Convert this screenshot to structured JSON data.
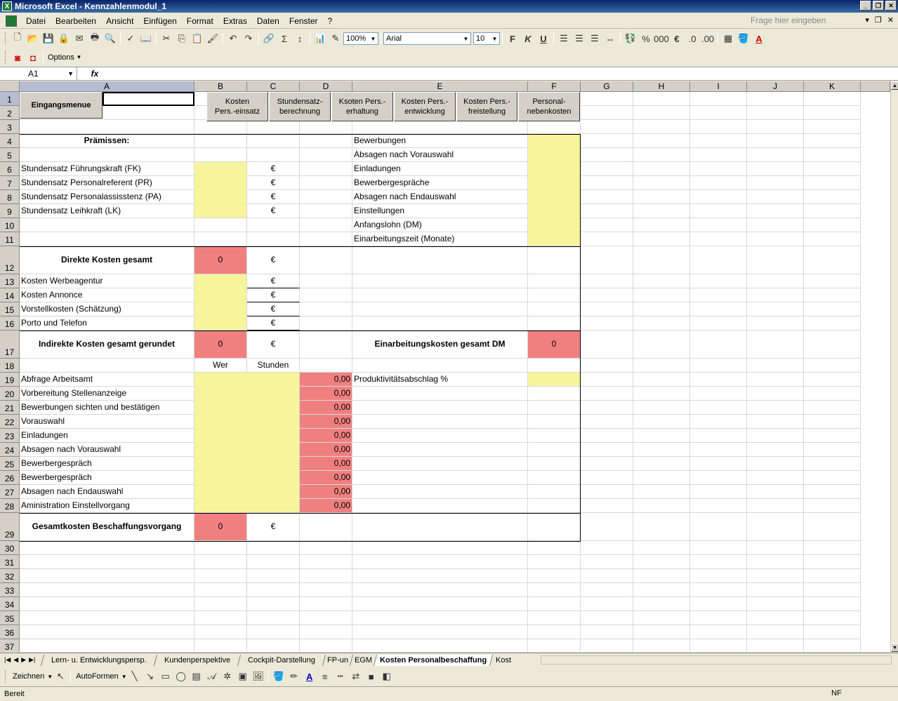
{
  "window": {
    "title": "Microsoft Excel - Kennzahlenmodul_1",
    "app_icon": "excel-icon"
  },
  "menu": [
    "Datei",
    "Bearbeiten",
    "Ansicht",
    "Einfügen",
    "Format",
    "Extras",
    "Daten",
    "Fenster",
    "?"
  ],
  "help_placeholder": "Frage hier eingeben",
  "toolbar": {
    "zoom": "100%",
    "font": "Arial",
    "size": "10",
    "bold": "F",
    "italic": "K",
    "underline": "U",
    "percent": "%",
    "thousands": "000",
    "euro": "€"
  },
  "toolbar2": {
    "options": "Options"
  },
  "namebox": "A1",
  "fx": "fx",
  "columns": [
    "A",
    "B",
    "C",
    "D",
    "E",
    "F",
    "G",
    "H",
    "I",
    "J",
    "K"
  ],
  "rows": [
    "1",
    "2",
    "3",
    "4",
    "5",
    "6",
    "7",
    "8",
    "9",
    "10",
    "11",
    "12",
    "13",
    "14",
    "15",
    "16",
    "17",
    "18",
    "19",
    "20",
    "21",
    "22",
    "23",
    "24",
    "25",
    "26",
    "27",
    "28",
    "29",
    "30",
    "31",
    "32",
    "33",
    "34",
    "35",
    "36",
    "37"
  ],
  "nav_buttons": {
    "menu": "Eingangsmenue",
    "b1": "Kosten\nPers.-einsatz",
    "b2": "Stundensatz-\nberechnung",
    "b3": "Ksoten Pers.-\nerhaltung",
    "b4": "Kosten Pers.-\nentwicklung",
    "b5": "Kosten Pers.-\nfreistellung",
    "b6": "Personal-\nnebenkosten"
  },
  "sheet": {
    "praemissen": "Prämissen:",
    "fk": "Stundensatz Führungskraft (FK)",
    "pr": "Stundensatz Personalreferent (PR)",
    "pa": "Stundensatz Personalassisstenz (PA)",
    "lk": "Stundensatz Leihkraft (LK)",
    "euro": "€",
    "direkte": "Direkte Kosten gesamt",
    "zero": "0",
    "werbe": "Kosten Werbeagentur",
    "annonce": "Kosten Annonce",
    "vorstell": "Vorstellkosten (Schätzung)",
    "porto": "Porto und Telefon",
    "indirekte": "Indirekte Kosten gesamt gerundet",
    "wer": "Wer",
    "stunden": "Stunden",
    "tasks": [
      "Abfrage Arbeitsamt",
      "Vorbereitung Stellenanzeige",
      "Bewerbungen sichten und bestätigen",
      "Vorauswahl",
      "Einladungen",
      "Absagen nach Vorauswahl",
      "Bewerbergespräch",
      "Bewerbergespräch",
      "Absagen nach Endauswahl",
      "Aministration Einstellvorgang"
    ],
    "task_value": "0,00",
    "gesamt": "Gesamtkosten Beschaffungsvorgang",
    "e_items": [
      "Bewerbungen",
      "Absagen nach Vorauswahl",
      "Einladungen",
      "Bewerbergespräche",
      "Absagen nach Endauswahl",
      "Einstellungen",
      "Anfangslohn (DM)",
      "Einarbeitungszeit (Monate)"
    ],
    "einarbeitung": "Einarbeitungskosten gesamt DM",
    "produktiv": "Produktivitätsabschlag  %"
  },
  "tabs": [
    "Lern- u. Entwicklungspersp.",
    "Kundenperspektive",
    "Cockpit-Darstellung",
    "FP-un",
    "EGM",
    "Kosten Personalbeschaffung",
    "Kost"
  ],
  "active_tab": 5,
  "drawbar": {
    "zeichnen": "Zeichnen",
    "autoformen": "AutoFormen"
  },
  "status": {
    "ready": "Bereit",
    "nf": "NF"
  },
  "colors": {
    "yellow": "#f6f59b",
    "red": "#f08080",
    "title": "#0a246a"
  }
}
